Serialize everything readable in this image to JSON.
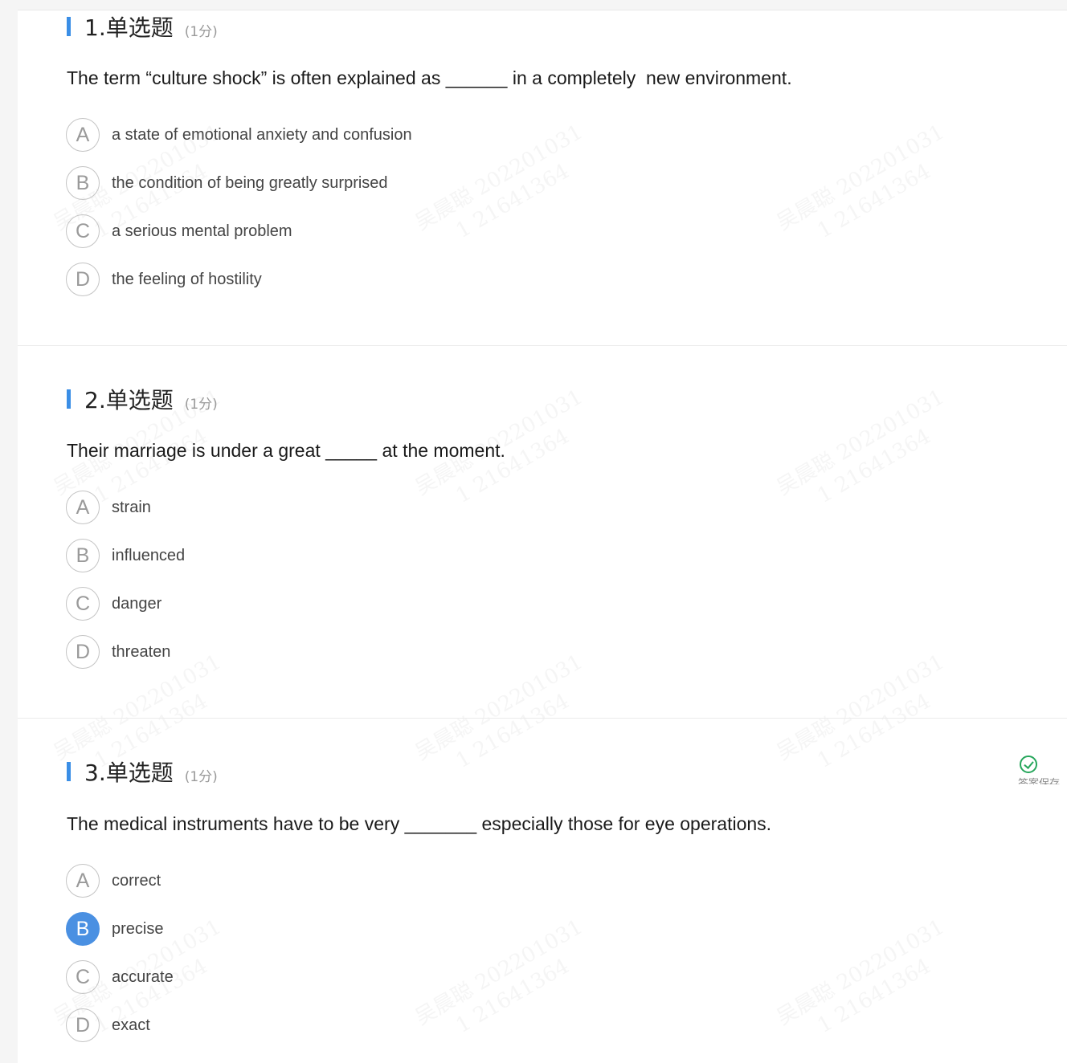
{
  "watermark": {
    "name_line": "吴晨聪 202201031",
    "id_line": "1 21641364"
  },
  "questions": [
    {
      "number_type": "1.单选题",
      "score": "(1分)",
      "stem": "The term “culture shock” is often explained as ______ in a completely  new environment.",
      "options": [
        {
          "letter": "A",
          "text": "a state of emotional anxiety and confusion",
          "selected": false
        },
        {
          "letter": "B",
          "text": "the condition of being greatly surprised",
          "selected": false
        },
        {
          "letter": "C",
          "text": "a serious mental problem",
          "selected": false
        },
        {
          "letter": "D",
          "text": "the feeling of hostility",
          "selected": false
        }
      ]
    },
    {
      "number_type": "2.单选题",
      "score": "(1分)",
      "stem": "Their marriage is under a great _____ at the moment.",
      "options": [
        {
          "letter": "A",
          "text": "strain",
          "selected": false
        },
        {
          "letter": "B",
          "text": "influenced",
          "selected": false
        },
        {
          "letter": "C",
          "text": "danger",
          "selected": false
        },
        {
          "letter": "D",
          "text": "threaten",
          "selected": false
        }
      ]
    },
    {
      "number_type": "3.单选题",
      "score": "(1分)",
      "stem": "The medical instruments have to be very _______ especially those for eye operations.",
      "options": [
        {
          "letter": "A",
          "text": "correct",
          "selected": false
        },
        {
          "letter": "B",
          "text": "precise",
          "selected": true
        },
        {
          "letter": "C",
          "text": "accurate",
          "selected": false
        },
        {
          "letter": "D",
          "text": "exact",
          "selected": false
        }
      ],
      "answer_status": "答案保存"
    }
  ],
  "colors": {
    "accent": "#4a90e2",
    "bar": "#3a8ee6",
    "check": "#26a65b"
  }
}
